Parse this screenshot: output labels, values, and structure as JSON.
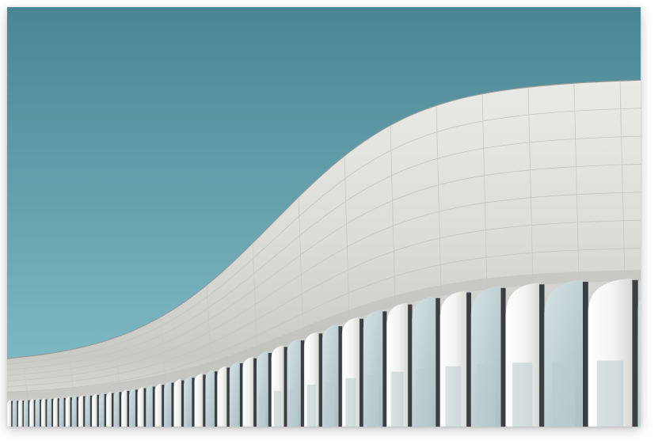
{
  "photo": {
    "subject": "",
    "colors": {
      "sky_top": "#4a8593",
      "sky_bottom": "#86c3cd",
      "facade_light": "#eeeeec",
      "facade_mid": "#d9d9d6",
      "facade_shadow": "#bdbdb9",
      "fin_white": "#f6f6f4",
      "glass": "#b9ccd0",
      "dark_gap": "#3b3f44"
    }
  }
}
